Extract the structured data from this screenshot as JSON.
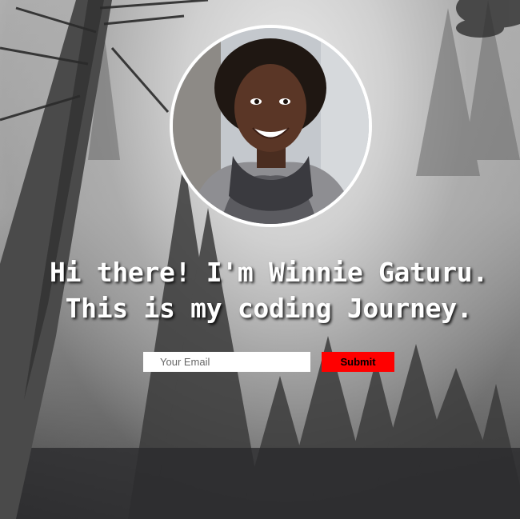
{
  "hero": {
    "background": "misty-forest-photo",
    "avatar": "profile-photo"
  },
  "headline": {
    "line1": "Hi there! I'm Winnie Gaturu.",
    "line2": "This is my coding Journey."
  },
  "signup": {
    "email_placeholder": "Your Email",
    "submit_label": "Submit"
  },
  "colors": {
    "submit_bg": "#ff0000",
    "text": "#ffffff",
    "avatar_border": "#ffffff"
  }
}
